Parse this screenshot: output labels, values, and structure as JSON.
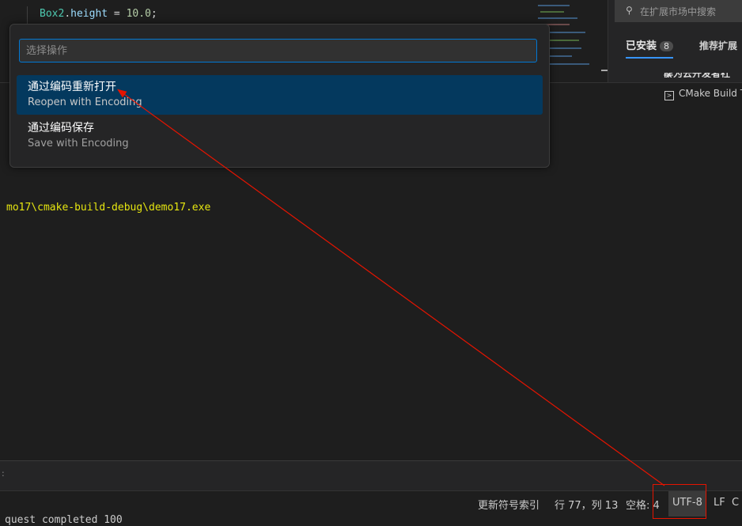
{
  "editor": {
    "code": {
      "object": "Box2",
      "dot": ".",
      "property": "height",
      "op": " = ",
      "value": "10.0",
      "end": ";"
    }
  },
  "extensions": {
    "search_placeholder": "在扩展市场中搜索",
    "tab_installed": "已安装",
    "installed_count": "8",
    "tab_recommended": "推荐扩展",
    "partial_text": "华为云开发者社区"
  },
  "panel": {
    "cmake_tab": "CMake Build T"
  },
  "terminal": {
    "path_line": "mo17\\cmake-build-debug\\demo17.exe",
    "bottom_line": "quest completed 100"
  },
  "quick_pick": {
    "placeholder": "选择操作",
    "items": [
      {
        "label": "通过编码重新打开",
        "description": "Reopen with Encoding"
      },
      {
        "label": "通过编码保存",
        "description": "Save with Encoding"
      }
    ]
  },
  "status_bar": {
    "update_index": "更新符号索引",
    "position": "行 77，列 13",
    "spaces": "空格: 4",
    "encoding": "UTF-8",
    "eol": "LF",
    "language": "C"
  },
  "colors": {
    "accent": "#0078d4",
    "selection": "#04395e",
    "annotation": "#e51400",
    "terminal_yellow": "#e5e510"
  }
}
